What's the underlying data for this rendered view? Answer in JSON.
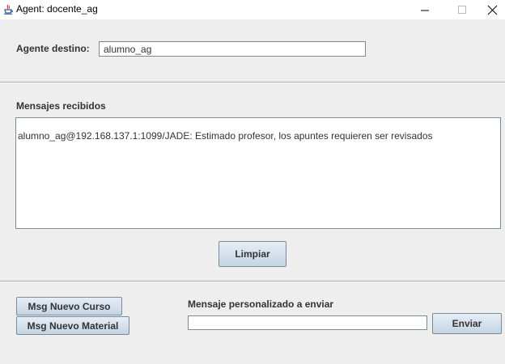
{
  "window": {
    "title": "Agent: docente_ag",
    "controls": {
      "minimize": "–",
      "maximize": "☐",
      "close": "✕"
    }
  },
  "destination": {
    "label": "Agente destino:",
    "value": "alumno_ag"
  },
  "received": {
    "label": "Mensajes recibidos",
    "messages": [
      "alumno_ag@192.168.137.1:1099/JADE: Estimado profesor, los apuntes requieren ser revisados"
    ],
    "clear_button": "Limpiar"
  },
  "actions": {
    "new_course_button": "Msg Nuevo Curso",
    "new_material_button": "Msg Nuevo Material",
    "custom_label": "Mensaje personalizado a enviar",
    "custom_value": "",
    "send_button": "Enviar"
  },
  "colors": {
    "window_bg": "#eeeeee",
    "button_gradient_top": "#e6eef6",
    "button_gradient_bottom": "#c5d4e3",
    "border": "#7a8a99"
  }
}
